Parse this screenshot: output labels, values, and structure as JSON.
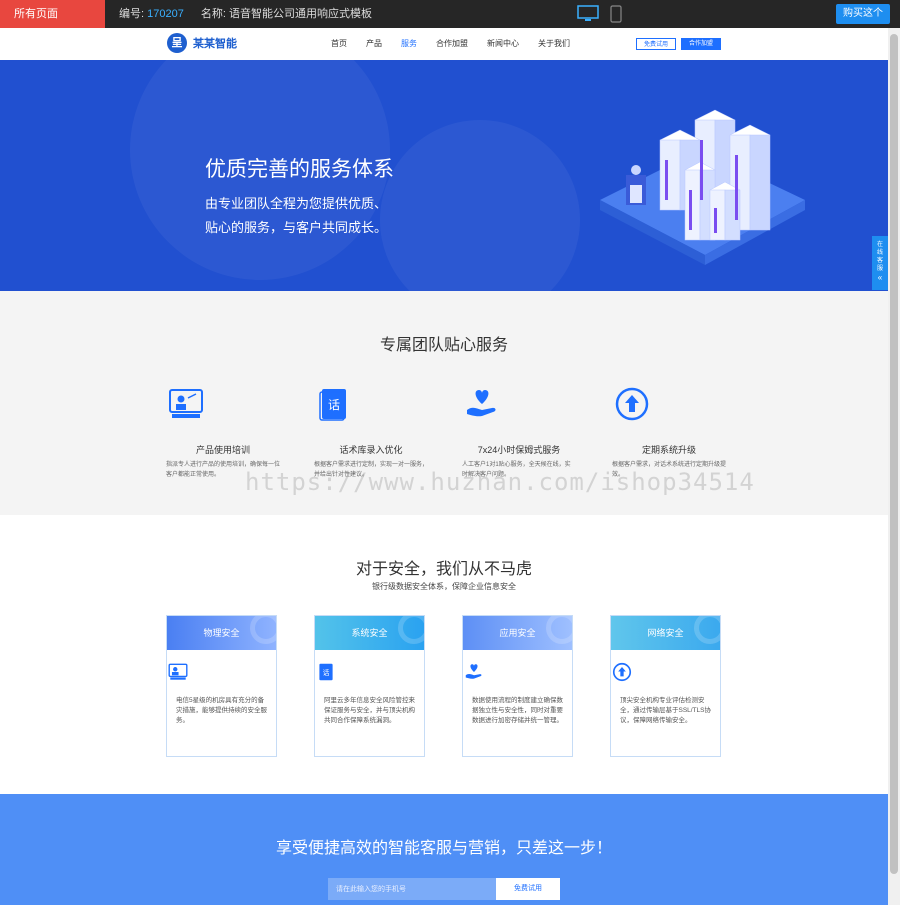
{
  "topbar": {
    "all_pages": "所有页面",
    "number_label": "编号:",
    "number": "170207",
    "name_label": "名称:",
    "name": "语音智能公司通用响应式模板",
    "buy": "购买这个"
  },
  "nav": {
    "logo_mark": "呈",
    "logo_text": "某某智能",
    "items": [
      "首页",
      "产品",
      "服务",
      "合作加盟",
      "新闻中心",
      "关于我们"
    ],
    "active_index": 2,
    "trial_btn": "免费试用",
    "join_btn": "合作加盟"
  },
  "hero": {
    "title": "优质完善的服务体系",
    "line1": "由专业团队全程为您提供优质、",
    "line2": "贴心的服务，与客户共同成长。"
  },
  "service": {
    "title": "专属团队贴心服务",
    "items": [
      {
        "title": "产品使用培训",
        "desc": "指派专人进行产品的使用培训，确保每一位客户都能正常使用。",
        "icon": "training-icon"
      },
      {
        "title": "话术库录入优化",
        "desc": "根据客户需求进行定制，实现一对一服务，并给出针对性建议。",
        "icon": "script-book-icon"
      },
      {
        "title": "7x24小时保姆式服务",
        "desc": "人工客户1对1贴心服务，全天候在线，实时解决客户问题。",
        "icon": "heart-hand-icon"
      },
      {
        "title": "定期系统升级",
        "desc": "根据客户需求，对话术系统进行定期升级提效。",
        "icon": "upgrade-icon"
      }
    ]
  },
  "security": {
    "title": "对于安全，我们从不马虎",
    "subtitle": "银行级数据安全体系，保障企业信息安全",
    "cards": [
      {
        "title": "物理安全",
        "desc": "电信5星级的机房具有充分的备灾措施，能够提供持续的安全服务。",
        "icon": "training-icon"
      },
      {
        "title": "系统安全",
        "desc": "阿里云多年信息安全风险管控来保证服务与安全，并与顶尖机构共同合作保障系统漏洞。",
        "icon": "script-book-icon"
      },
      {
        "title": "应用安全",
        "desc": "数据使用流程的制度建立确保数据独立性与安全性，同时对重要数据进行加密存储并统一管理。",
        "icon": "heart-hand-icon"
      },
      {
        "title": "网络安全",
        "desc": "顶尖安全机构专业评估检测安全，通过传输层基于SSL/TLS协议，保障网络传输安全。",
        "icon": "upgrade-icon"
      }
    ]
  },
  "cta": {
    "title": "享受便捷高效的智能客服与营销，只差这一步！",
    "input_placeholder": "请在此输入您的手机号",
    "button": "免费试用"
  },
  "side": {
    "label": "在线客服",
    "arrow": "«"
  },
  "watermark": "https://www.huzhan.com/ishop34514",
  "colors": {
    "primary": "#1e6fff",
    "hero_bg": "#2150d0",
    "cta_bg": "#4f8ff6",
    "topbar_bg": "#262626",
    "all_pages_bg": "#e8473f"
  }
}
